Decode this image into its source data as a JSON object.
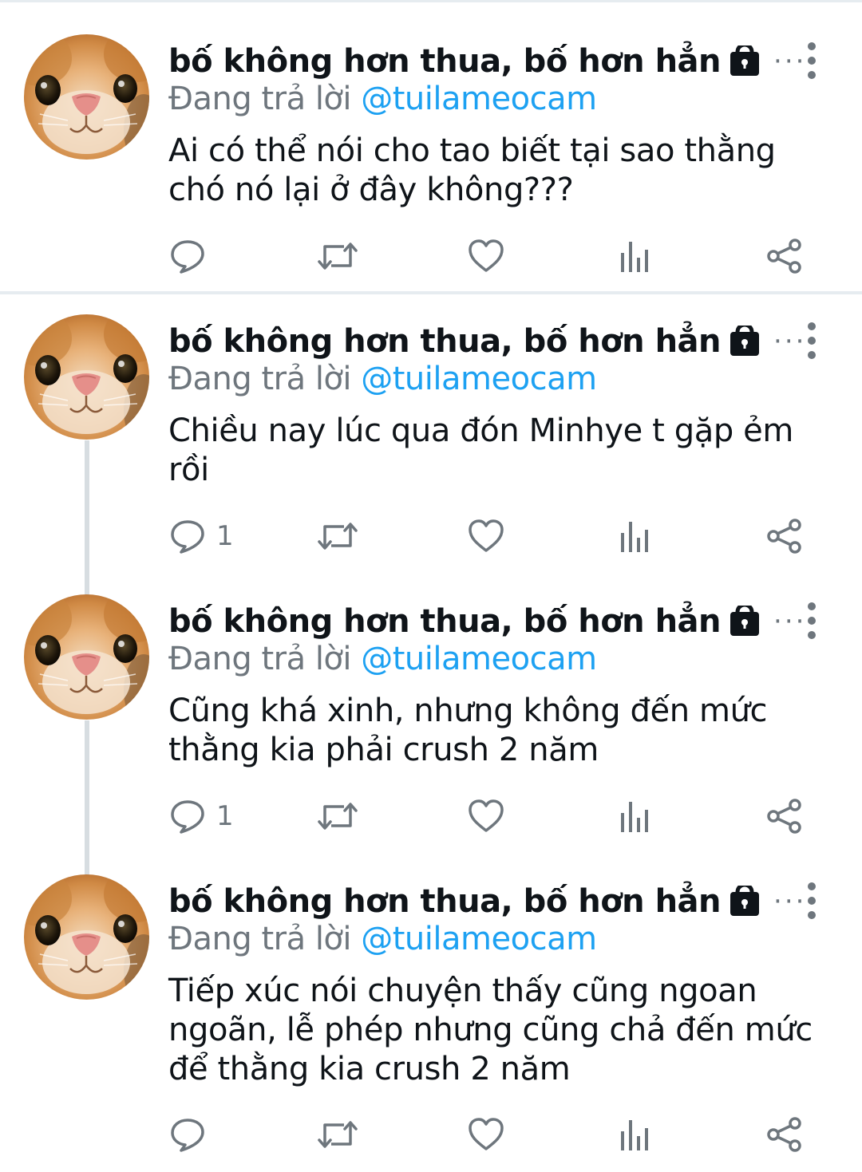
{
  "colors": {
    "link": "#1da1f2",
    "secondary_text": "#6e767d",
    "primary_text": "#0f1419",
    "divider": "#e6ecf0",
    "thread_line": "#d7dde1"
  },
  "icons": {
    "lock": "lock-icon",
    "more_inline": "horizontal-dots",
    "more_menu": "vertical-dots",
    "reply": "speech-bubble",
    "retweet": "retweet-arrows",
    "like": "heart",
    "analytics": "bar-chart",
    "share": "share-nodes"
  },
  "tweets": [
    {
      "display_name": "bố không hơn thua, bố hơn hẳn",
      "more_inline": "···",
      "reply_prefix": "Đang trả lời",
      "reply_handle": "@tuilameocam",
      "text": "Ai có thể nói cho tao biết tại sao thằng chó nó lại ở đây không???",
      "reply_count": ""
    },
    {
      "display_name": "bố không hơn thua, bố hơn hẳn",
      "more_inline": "···",
      "reply_prefix": "Đang trả lời",
      "reply_handle": "@tuilameocam",
      "text": "Chiều nay lúc qua đón Minhye t gặp ẻm rồi",
      "reply_count": "1"
    },
    {
      "display_name": "bố không hơn thua, bố hơn hẳn",
      "more_inline": "···",
      "reply_prefix": "Đang trả lời",
      "reply_handle": "@tuilameocam",
      "text": "Cũng khá xinh, nhưng không đến mức thằng kia phải crush 2 năm",
      "reply_count": "1"
    },
    {
      "display_name": "bố không hơn thua, bố hơn hẳn",
      "more_inline": "···",
      "reply_prefix": "Đang trả lời",
      "reply_handle": "@tuilameocam",
      "text": "Tiếp xúc nói chuyện thấy cũng ngoan ngoãn, lễ phép nhưng cũng chả đến mức để thằng kia crush 2 năm",
      "reply_count": ""
    }
  ]
}
